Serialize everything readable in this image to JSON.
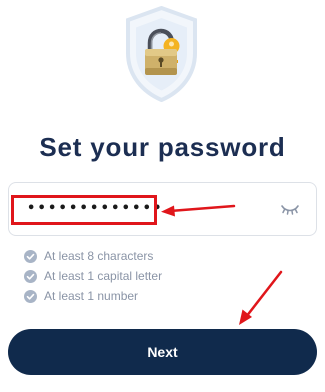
{
  "page": {
    "title": "Set your password"
  },
  "password_field": {
    "value": "•••••••••••••",
    "visibility_icon": "eye-closed-icon"
  },
  "requirements": [
    {
      "label": "At least 8 characters",
      "icon": "check-circle-icon"
    },
    {
      "label": "At least 1 capital letter",
      "icon": "check-circle-icon"
    },
    {
      "label": "At least 1 number",
      "icon": "check-circle-icon"
    }
  ],
  "next_button": {
    "label": "Next"
  },
  "colors": {
    "title": "#1c2e52",
    "button": "#102a4c",
    "annotation": "#e0161b",
    "check": "#a8b4c6"
  },
  "illustration": {
    "icon": "shield-lock-icon"
  }
}
